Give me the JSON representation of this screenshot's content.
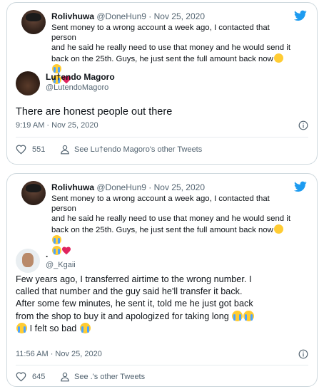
{
  "colors": {
    "accent": "#1d9bf0",
    "text": "#0f1419",
    "muted": "#536471",
    "border": "#cfd9de",
    "heart": "#e0245e"
  },
  "icons": {
    "brand": "twitter-bird-icon",
    "info": "info-icon",
    "like": "heart-outline-icon",
    "user": "user-icon"
  },
  "tweets": [
    {
      "quoted": {
        "name": "Rolivhuwa",
        "handle": "@DoneHun9",
        "separator": "·",
        "date": "Nov 25, 2020",
        "lines": [
          "Sent money to a wrong account a week ago, I contacted that person",
          "and he said he really need to use that money and he would send it",
          "back on the 25th. Guys, he just sent the full amount back now"
        ]
      },
      "author": {
        "name": "Lu†endo Magoro",
        "handle": "@LutendoMagoro"
      },
      "text_lines": [
        "There are honest people out there"
      ],
      "timestamp": "9:19 AM · Nov 25, 2020",
      "likes": "551",
      "other_tweets": "See Lu†endo Magoro's other Tweets"
    },
    {
      "quoted": {
        "name": "Rolivhuwa",
        "handle": "@DoneHun9",
        "separator": "·",
        "date": "Nov 25, 2020",
        "lines": [
          "Sent money to a wrong account a week ago, I contacted that person",
          "and he said he really need to use that money and he would send it",
          "back on the 25th. Guys, he just sent the full amount back now"
        ]
      },
      "author": {
        "name": ".",
        "handle": "@_Kgaii"
      },
      "text_lines": [
        "Few years ago, I transferred airtime to the wrong number. I",
        "called that number and the guy said he'll transfer it back.",
        "After some few minutes, he sent it, told me he just got back",
        "from the shop to buy it and apologized for taking long",
        "I felt so bad"
      ],
      "timestamp": "11:56 AM · Nov 25, 2020",
      "likes": "645",
      "other_tweets": "See .'s other Tweets"
    }
  ]
}
